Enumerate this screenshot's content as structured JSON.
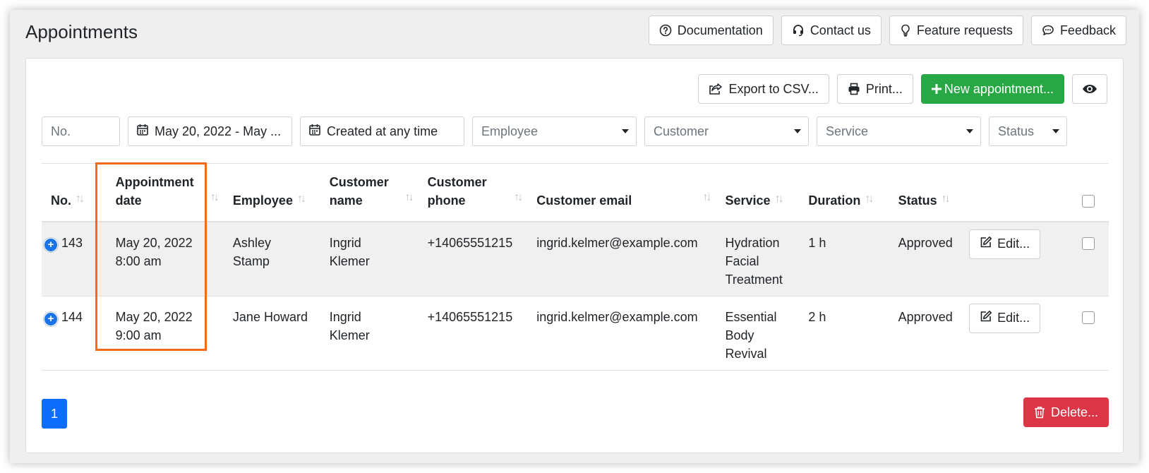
{
  "header": {
    "title": "Appointments",
    "buttons": {
      "documentation": "Documentation",
      "contact": "Contact us",
      "feature": "Feature requests",
      "feedback": "Feedback"
    }
  },
  "actions": {
    "export": "Export to CSV...",
    "print": "Print...",
    "new": "New appointment..."
  },
  "filters": {
    "number_placeholder": "No.",
    "date_range": "May 20, 2022 - May ...",
    "created": "Created at any time",
    "employee": "Employee",
    "customer": "Customer",
    "service": "Service",
    "status": "Status"
  },
  "table": {
    "columns": {
      "no": "No.",
      "date_line1": "Appointment",
      "date_line2": "date",
      "employee": "Employee",
      "cname_line1": "Customer",
      "cname_line2": "name",
      "cphone_line1": "Customer",
      "cphone_line2": "phone",
      "email": "Customer email",
      "service": "Service",
      "duration": "Duration",
      "status": "Status"
    },
    "rows": [
      {
        "no": "143",
        "date": "May 20, 2022",
        "time": "8:00 am",
        "employee_line1": "Ashley",
        "employee_line2": "Stamp",
        "cname_line1": "Ingrid",
        "cname_line2": "Klemer",
        "phone": "+14065551215",
        "email": "ingrid.kelmer@example.com",
        "service_line1": "Hydration",
        "service_line2": "Facial",
        "service_line3": "Treatment",
        "duration": "1 h",
        "status": "Approved",
        "edit": "Edit..."
      },
      {
        "no": "144",
        "date": "May 20, 2022",
        "time": "9:00 am",
        "employee_line1": "Jane Howard",
        "employee_line2": "",
        "cname_line1": "Ingrid",
        "cname_line2": "Klemer",
        "phone": "+14065551215",
        "email": "ingrid.kelmer@example.com",
        "service_line1": "Essential",
        "service_line2": "Body",
        "service_line3": "Revival",
        "duration": "2 h",
        "status": "Approved",
        "edit": "Edit..."
      }
    ]
  },
  "pagination": {
    "current": "1"
  },
  "footer": {
    "delete": "Delete..."
  },
  "colors": {
    "accent_green": "#28a745",
    "danger_red": "#dc3545",
    "primary_blue": "#0d6efd",
    "highlight_orange": "#f26a1b"
  }
}
